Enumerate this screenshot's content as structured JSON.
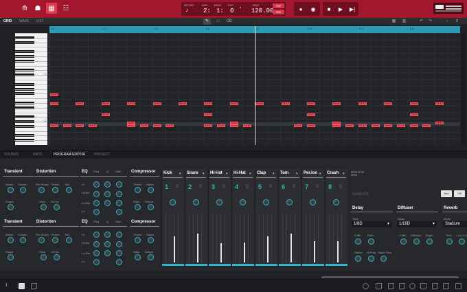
{
  "transport": {
    "metro_label": "METRO",
    "bar_label": "BAR",
    "beat_label": "BEAT",
    "tick_label": "TICK",
    "bpm_label": "BPM",
    "bar": "2:",
    "beat": "1:",
    "tick": "0",
    "bpm": "120.00",
    "tap_label": "TAP",
    "sig_label": "SIG"
  },
  "view_tabs": [
    "GRID",
    "WAVE",
    "LIST"
  ],
  "ruler_ticks": [
    "1.1",
    "1.2",
    "1.3",
    "1.4",
    "2.1",
    "2.2",
    "2.3",
    "2.4"
  ],
  "key_labels": [
    "C3",
    "C2"
  ],
  "panel_tabs": [
    "SOUNDS",
    "PADS",
    "PROGRAM EDITOR",
    "PROJECT"
  ],
  "fx_rows": [
    {
      "transient": "Transient",
      "attack": "Attack",
      "sustain": "Sustain",
      "shape": "Shape",
      "distortion": "Distortion",
      "preshape": "Pre-Shape",
      "thresh": "Thresh",
      "mix": "Mix",
      "drive": "Drive",
      "hicut": "Hi-Cut",
      "eq": "EQ",
      "freq": "Freq",
      "q": "Q",
      "gain": "Gain",
      "hi": "Hi",
      "himid": "Hi Mid",
      "lomid": "Lo Mid",
      "lo": "Lo",
      "compressor": "Compressor",
      "cthresh": "Thresh",
      "cattack": "Attack",
      "ratio": "Ratio",
      "output": "Output"
    },
    {
      "transient": "Transient",
      "attack": "Attack",
      "sustain": "Sustain",
      "shape": "Shape",
      "distortion": "Distortion",
      "preshape": "Pre-Shape",
      "thresh": "Thresh",
      "mix": "Mix",
      "drive": "Drive",
      "hicut": "Hi-Cut",
      "eq": "EQ",
      "freq": "Freq",
      "q": "Q",
      "gain": "Gain",
      "hi": "Hi",
      "himid": "Hi Mid",
      "lomid": "Lo Mid",
      "lo": "Lo",
      "compressor": "Compressor",
      "cthresh": "Thresh",
      "cattack": "Attack",
      "ratio": "Ratio",
      "output": "Output"
    }
  ],
  "channels": [
    {
      "name": "Kick",
      "num": "1",
      "s": "S",
      "level": 0.55
    },
    {
      "name": "Snare",
      "num": "2",
      "s": "S",
      "level": 0.6
    },
    {
      "name": "Hi-Hat",
      "num": "3",
      "s": "S",
      "level": 0.4
    },
    {
      "name": "Hi-Hat",
      "num": "4",
      "s": "S",
      "level": 0.42
    },
    {
      "name": "Clap",
      "num": "5",
      "s": "S",
      "level": 0.55
    },
    {
      "name": "Tom",
      "num": "6",
      "s": "S",
      "level": 0.6
    },
    {
      "name": "Per.ion",
      "num": "7",
      "s": "S",
      "level": 0.45
    },
    {
      "name": "Crash",
      "num": "8",
      "s": "S",
      "level": 0.45
    }
  ],
  "send": {
    "title": "Send FX",
    "btn_1": "Bnd",
    "btn_2": "Diff",
    "delay": "Delay",
    "time": "Time",
    "time_val": "1/8D",
    "fdbk": "FdBk",
    "ratio": "Ratio",
    "stereo": "Stereo",
    "hifreq": "Hi Freq",
    "basefreq": "Base Freq",
    "diffuser": "Diffuser",
    "delay2": "Delay",
    "delay2_val": "1/16D",
    "fdbk2": "FdBk",
    "diffusion": "Diffusion",
    "bright": "Bright",
    "reverb": "Reverb",
    "mode": "Mode",
    "mode_val": "Stadium",
    "rtime": "Time",
    "lowcut": "Low Cut"
  },
  "colors": {
    "accent": "#a3172e",
    "cyan": "#2fb7c9",
    "note": "#d12d3f"
  }
}
